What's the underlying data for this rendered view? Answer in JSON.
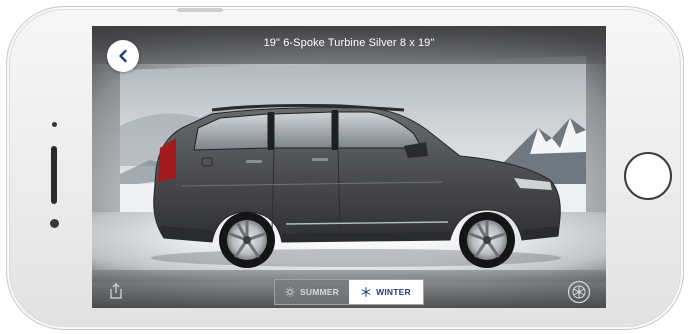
{
  "screen": {
    "title": "19\" 6-Spoke Turbine Silver   8 x 19\""
  },
  "season_toggle": {
    "options": [
      {
        "label": "SUMMER",
        "icon": "sun-icon",
        "selected": false
      },
      {
        "label": "WINTER",
        "icon": "snowflake-icon",
        "selected": true
      }
    ]
  },
  "colors": {
    "selected_text": "#1f3f7a",
    "car_body": "#4b4c50"
  }
}
